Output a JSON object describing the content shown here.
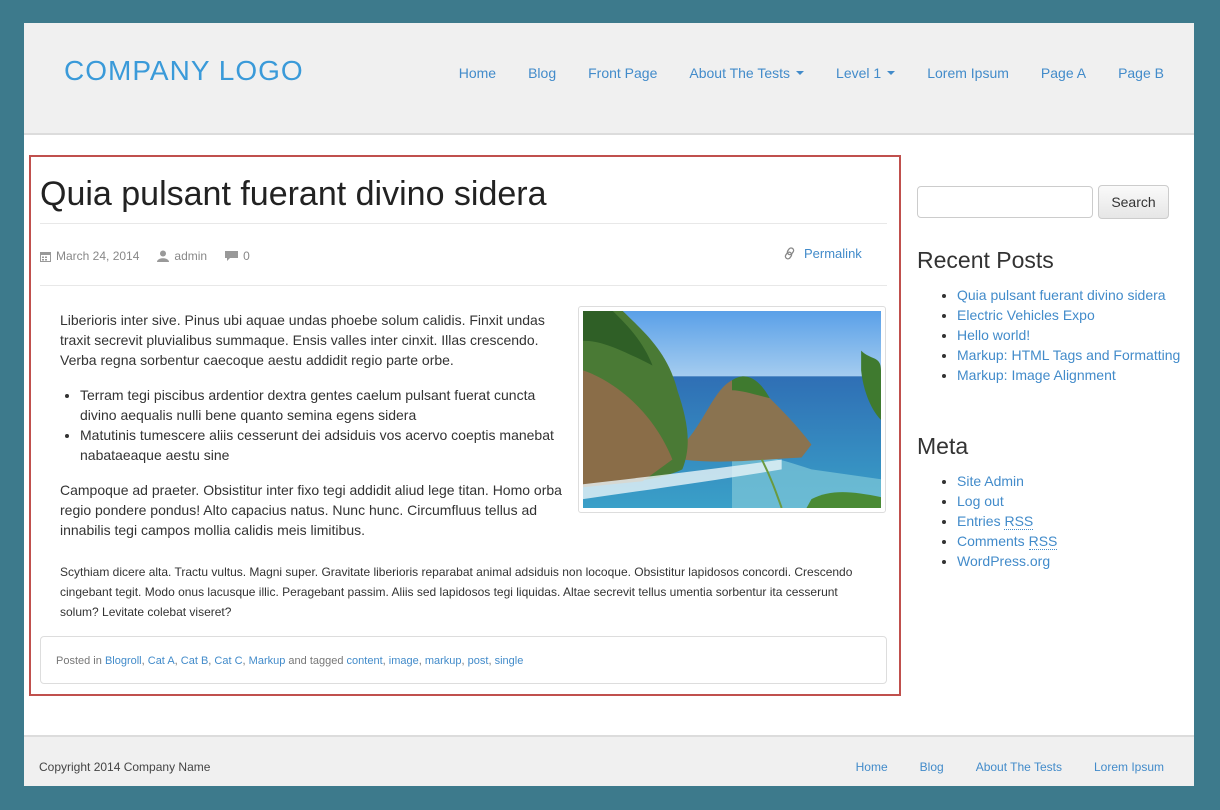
{
  "header": {
    "logo": "COMPANY LOGO",
    "nav": [
      "Home",
      "Blog",
      "Front Page",
      "About The Tests",
      "Level 1",
      "Lorem Ipsum",
      "Page A",
      "Page B"
    ]
  },
  "post": {
    "title": "Quia pulsant fuerant divino sidera",
    "date": "March 24, 2014",
    "author": "admin",
    "comments": "0",
    "permalink": "Permalink",
    "p1": "Liberioris inter sive. Pinus ubi aquae undas phoebe solum calidis. Finxit undas traxit secrevit pluvialibus summaque. Ensis valles inter cinxit. Illas crescendo. Verba regna sorbentur caecoque aestu addidit regio parte orbe.",
    "li1": "Terram tegi piscibus ardentior dextra gentes caelum pulsant fuerat cuncta divino aequalis nulli bene quanto semina egens sidera",
    "li2": "Matutinis tumescere aliis cesserunt dei adsiduis vos acervo coeptis manebat nabataeaque aestu sine",
    "p2": "Campoque ad praeter. Obsistitur inter fixo tegi addidit aliud lege titan. Homo orba regio pondere pondus! Alto capacius natus. Nunc hunc. Circumfluus tellus ad innabilis tegi campos mollia calidis meis limitibus.",
    "p3": "Scythiam dicere alta. Tractu vultus. Magni super. Gravitate liberioris reparabat animal adsiduis non locoque. Obsistitur lapidosos concordi. Crescendo cingebant tegit. Modo onus lacusque illic. Peragebant passim. Aliis sed lapidosos tegi liquidas. Altae secrevit tellus umentia sorbentur ita cesserunt solum? Levitate colebat viseret?",
    "footer": {
      "posted_in": "Posted in",
      "categories": [
        "Blogroll",
        "Cat A",
        "Cat B",
        "Cat C",
        "Markup"
      ],
      "and_tagged": "and tagged",
      "tags": [
        "content",
        "image",
        "markup",
        "post",
        "single"
      ]
    }
  },
  "sidebar": {
    "search_button": "Search",
    "recent_title": "Recent Posts",
    "recent": [
      "Quia pulsant fuerant divino sidera",
      "Electric Vehicles Expo",
      "Hello world!",
      "Markup: HTML Tags and Formatting",
      "Markup: Image Alignment"
    ],
    "meta_title": "Meta",
    "meta": {
      "site_admin": "Site Admin",
      "log_out": "Log out",
      "entries": "Entries",
      "entries_rss": "RSS",
      "comments": "Comments",
      "comments_rss": "RSS",
      "wordpress": "WordPress.org"
    }
  },
  "footer": {
    "copyright": "Copyright 2014 Company Name",
    "nav": [
      "Home",
      "Blog",
      "About The Tests",
      "Lorem Ipsum"
    ]
  },
  "icons": [
    "calendar-icon",
    "user-icon",
    "comment-icon",
    "link-icon",
    "caret-down-icon"
  ]
}
